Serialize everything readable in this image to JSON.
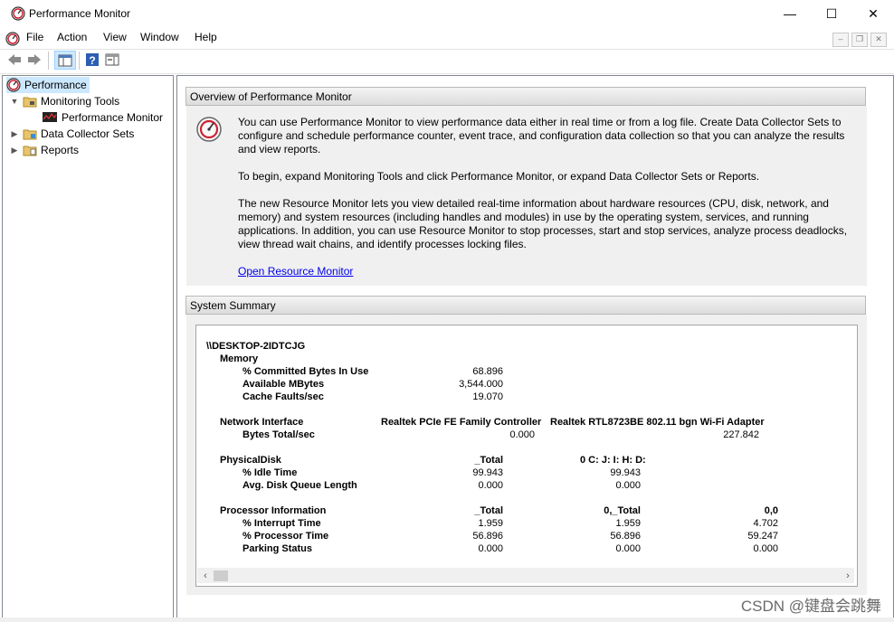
{
  "window": {
    "title": "Performance Monitor",
    "minimize": "—",
    "maximize": "☐",
    "close": "✕"
  },
  "menu": {
    "items": [
      "File",
      "Action",
      "View",
      "Window",
      "Help"
    ]
  },
  "tree": {
    "items": [
      {
        "label": "Performance",
        "selected": true
      },
      {
        "label": "Monitoring Tools"
      },
      {
        "label": "Performance Monitor"
      },
      {
        "label": "Data Collector Sets"
      },
      {
        "label": "Reports"
      }
    ]
  },
  "overview": {
    "header": "Overview of Performance Monitor",
    "p1": "You can use Performance Monitor to view performance data either in real time or from a log file. Create Data Collector Sets to configure and schedule performance counter, event trace, and configuration data collection so that you can analyze the results and view reports.",
    "p2": "To begin, expand Monitoring Tools and click Performance Monitor, or expand Data Collector Sets or Reports.",
    "p3": "The new Resource Monitor lets you view detailed real-time information about hardware resources (CPU, disk, network, and memory) and system resources (including handles and modules) in use by the operating system, services, and running applications. In addition, you can use Resource Monitor to stop processes, start and stop services, analyze process deadlocks, view thread wait chains, and identify processes locking files.",
    "link": "Open Resource Monitor"
  },
  "summary": {
    "header": "System Summary",
    "host": "\\\\DESKTOP-2IDTCJG",
    "memory": {
      "label": "Memory",
      "committed_label": "% Committed Bytes In Use",
      "committed": "68.896",
      "available_label": "Available MBytes",
      "available": "3,544.000",
      "cache_label": "Cache Faults/sec",
      "cache": "19.070"
    },
    "network": {
      "label": "Network Interface",
      "col1": "Realtek PCIe FE Family Controller",
      "col2": "Realtek RTL8723BE 802.11 bgn Wi-Fi Adapter",
      "bytes_label": "Bytes Total/sec",
      "bytes1": "0.000",
      "bytes2": "227.842"
    },
    "disk": {
      "label": "PhysicalDisk",
      "col1": "_Total",
      "col2": "0 C: J: I: H: D:",
      "idle_label": "% Idle Time",
      "idle1": "99.943",
      "idle2": "99.943",
      "queue_label": "Avg. Disk Queue Length",
      "queue1": "0.000",
      "queue2": "0.000"
    },
    "processor": {
      "label": "Processor Information",
      "col1": "_Total",
      "col2": "0,_Total",
      "col3": "0,0",
      "interrupt_label": "% Interrupt Time",
      "int1": "1.959",
      "int2": "1.959",
      "int3": "4.702",
      "proc_label": "% Processor Time",
      "proc1": "56.896",
      "proc2": "56.896",
      "proc3": "59.247",
      "park_label": "Parking Status",
      "park1": "0.000",
      "park2": "0.000",
      "park3": "0.000"
    }
  },
  "watermark": "CSDN @键盘会跳舞",
  "colors": {
    "link": "#0000ee",
    "selected": "#cce8ff",
    "panel": "#f0f0f0"
  }
}
